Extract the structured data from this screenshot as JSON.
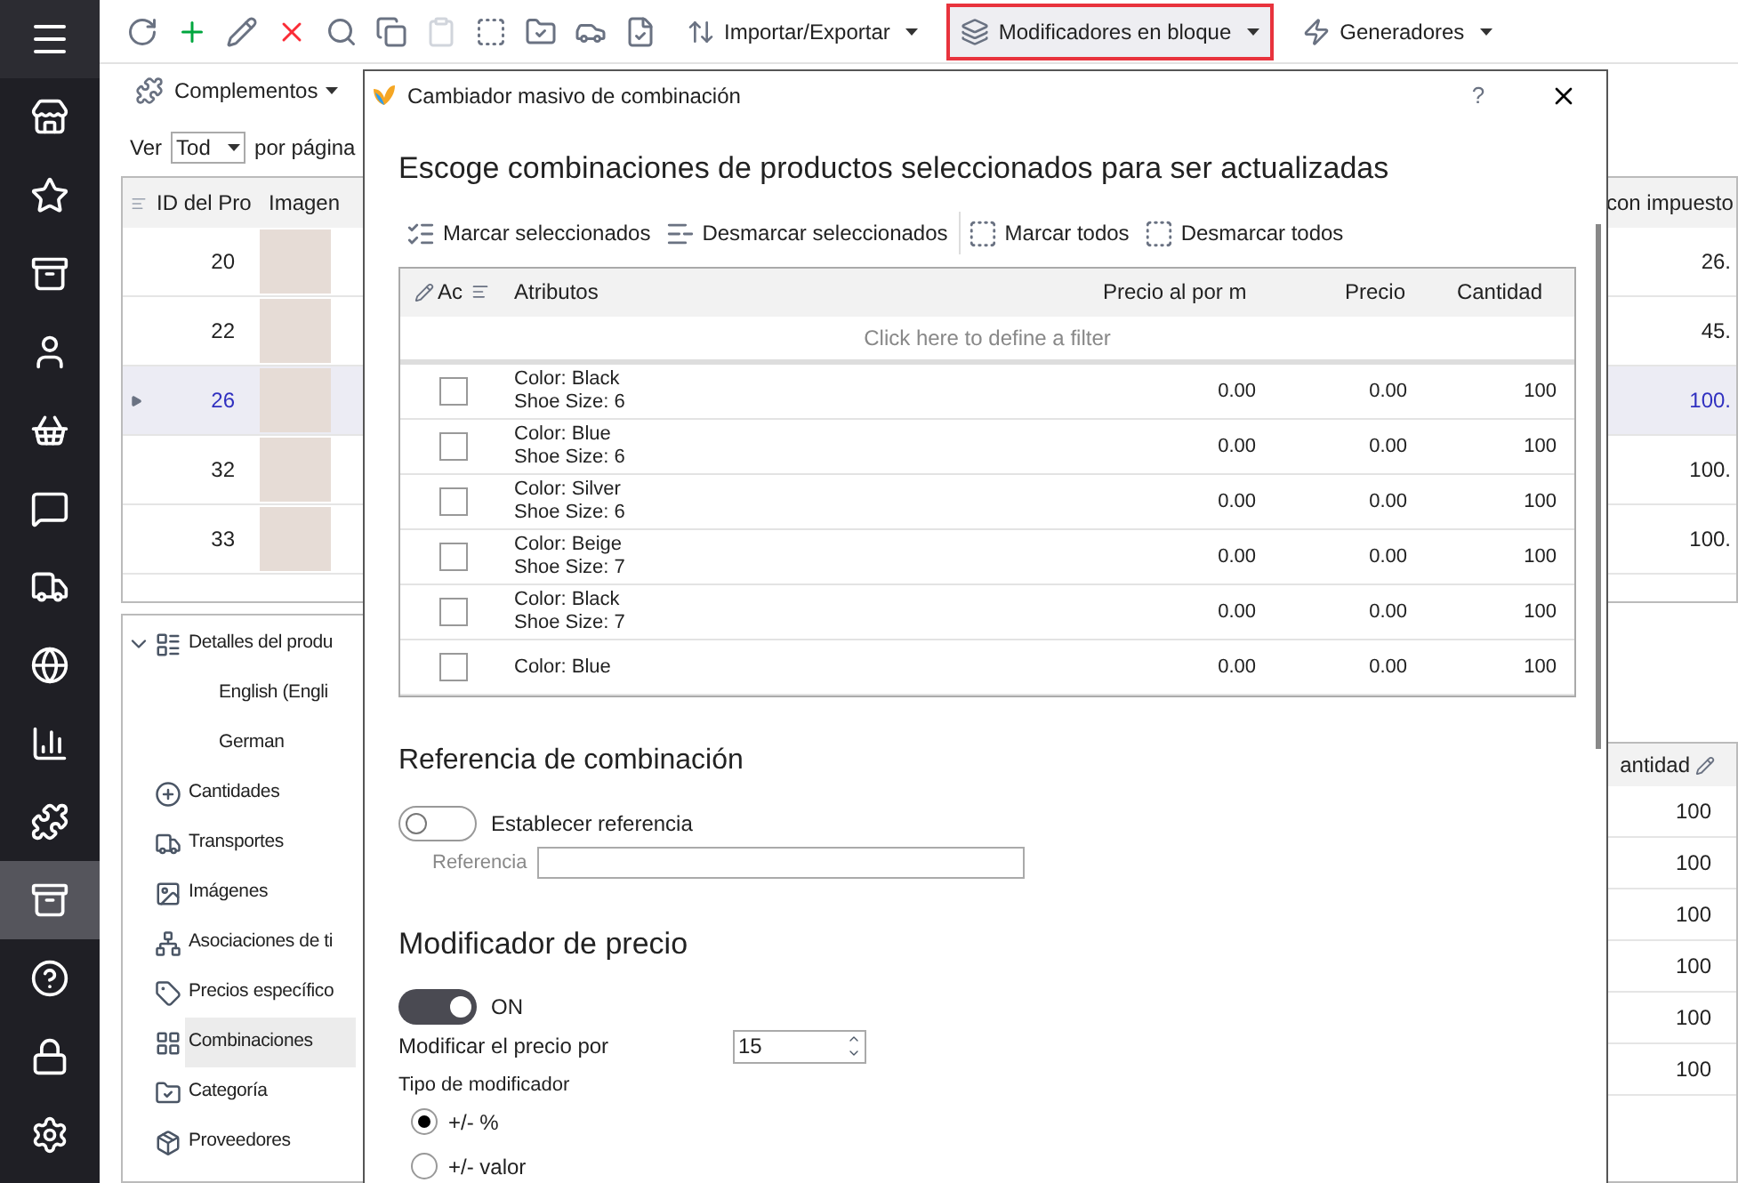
{
  "sidebar": {
    "items": [
      {
        "selected": false
      },
      {
        "selected": false
      },
      {
        "selected": false
      },
      {
        "selected": false
      },
      {
        "selected": false
      },
      {
        "selected": false
      },
      {
        "selected": false
      },
      {
        "selected": false
      },
      {
        "selected": false
      },
      {
        "selected": false
      },
      {
        "selected": true
      },
      {
        "selected": false
      },
      {
        "selected": false
      },
      {
        "selected": false
      }
    ]
  },
  "toolbar": {
    "menus": [
      {
        "label": "Importar/Exportar",
        "highlighted": false
      },
      {
        "label": "Modificadores en bloque",
        "highlighted": true
      },
      {
        "label": "Generadores",
        "highlighted": false
      }
    ]
  },
  "module_menu": {
    "label": "Complementos"
  },
  "paging": {
    "prefix": "Ver",
    "value": "Tod",
    "suffix": "por página"
  },
  "products_grid": {
    "columns": [
      "ID del Pro",
      "Imagen",
      "con impuesto"
    ],
    "rows": [
      {
        "id": "20",
        "price": "26.",
        "selected": false
      },
      {
        "id": "22",
        "price": "45.",
        "selected": false
      },
      {
        "id": "26",
        "price": "100.",
        "selected": true
      },
      {
        "id": "32",
        "price": "100.",
        "selected": false
      },
      {
        "id": "33",
        "price": "100.",
        "selected": false
      }
    ]
  },
  "details_tree": {
    "items": [
      {
        "label": "Detalles del produ",
        "expanded": true,
        "selected": false,
        "children": [
          {
            "label": "English (Engli",
            "selected": false
          },
          {
            "label": "German",
            "selected": false
          }
        ]
      },
      {
        "label": "Cantidades",
        "selected": false
      },
      {
        "label": "Transportes",
        "selected": false
      },
      {
        "label": "Imágenes",
        "selected": false
      },
      {
        "label": "Asociaciones de ti",
        "selected": false
      },
      {
        "label": "Precios específico",
        "selected": false
      },
      {
        "label": "Combinaciones",
        "selected": true
      },
      {
        "label": "Categoría",
        "selected": false
      },
      {
        "label": "Proveedores",
        "selected": false
      }
    ]
  },
  "quantities_grid": {
    "column": "antidad",
    "rows": [
      "100",
      "100",
      "100",
      "100",
      "100",
      "100"
    ]
  },
  "dialog": {
    "title": "Cambiador masivo de combinación",
    "help": "?",
    "heading": "Escoge combinaciones de productos seleccionados para ser actualizadas",
    "actions": [
      "Marcar seleccionados",
      "Desmarcar seleccionados",
      "Marcar todos",
      "Desmarcar todos"
    ],
    "grid": {
      "columns": [
        "Ac",
        "Atributos",
        "Precio al por m",
        "Precio",
        "Cantidad"
      ],
      "filter_hint": "Click here to define a filter",
      "rows": [
        {
          "checked": false,
          "attributes": [
            "Color: Black",
            "Shoe Size: 6"
          ],
          "wholesale": "0.00",
          "price": "0.00",
          "quantity": "100"
        },
        {
          "checked": false,
          "attributes": [
            "Color: Blue",
            "Shoe Size: 6"
          ],
          "wholesale": "0.00",
          "price": "0.00",
          "quantity": "100"
        },
        {
          "checked": false,
          "attributes": [
            "Color: Silver",
            "Shoe Size: 6"
          ],
          "wholesale": "0.00",
          "price": "0.00",
          "quantity": "100"
        },
        {
          "checked": false,
          "attributes": [
            "Color: Beige",
            "Shoe Size: 7"
          ],
          "wholesale": "0.00",
          "price": "0.00",
          "quantity": "100"
        },
        {
          "checked": false,
          "attributes": [
            "Color: Black",
            "Shoe Size: 7"
          ],
          "wholesale": "0.00",
          "price": "0.00",
          "quantity": "100"
        },
        {
          "checked": false,
          "attributes": [
            "Color: Blue"
          ],
          "wholesale": "0.00",
          "price": "0.00",
          "quantity": "100"
        }
      ]
    },
    "reference": {
      "heading": "Referencia de combinación",
      "toggle_label": "Establecer referencia",
      "on": false,
      "field_label": "Referencia"
    },
    "price_modifier": {
      "heading": "Modificador de precio",
      "on": true,
      "state_label": "ON",
      "amount_label": "Modificar el precio por",
      "amount": "15",
      "type_label": "Tipo de modificador",
      "types": [
        {
          "label": "+/- %",
          "selected": true
        },
        {
          "label": "+/- valor",
          "selected": false
        }
      ]
    }
  }
}
